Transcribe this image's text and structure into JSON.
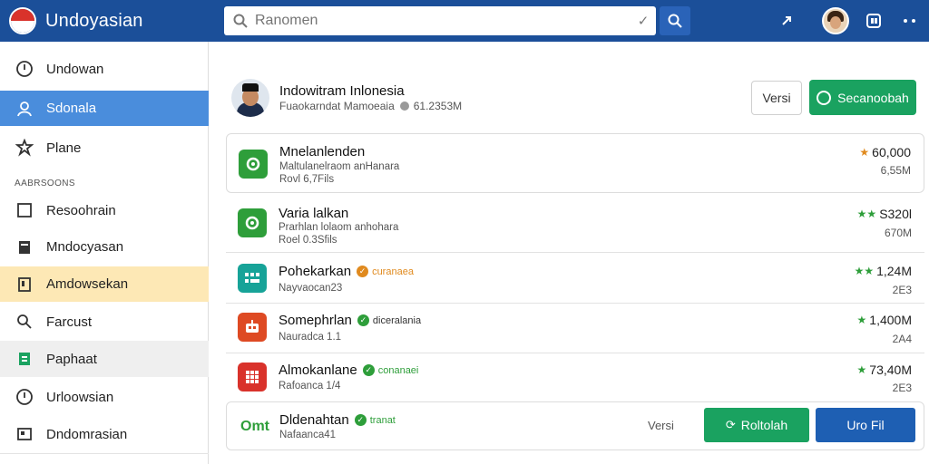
{
  "app": {
    "title": "Undoyasian"
  },
  "search": {
    "placeholder": "Ranomen"
  },
  "sidebar": {
    "items": [
      {
        "label": "Undowan",
        "icon": "compass-icon"
      },
      {
        "label": "Sdonala",
        "icon": "user-icon",
        "state": "active"
      },
      {
        "label": "Plane",
        "icon": "puzzle-icon"
      }
    ],
    "section_label": "AABRSOONS",
    "section_items": [
      {
        "label": "Resoohrain",
        "icon": "square-icon"
      },
      {
        "label": "Mndocyasan",
        "icon": "document-icon"
      },
      {
        "label": "Amdowsekan",
        "icon": "tablet-icon",
        "state": "highlighted"
      },
      {
        "label": "Farcust",
        "icon": "search-icon"
      },
      {
        "label": "Paphaat",
        "icon": "sheet-icon",
        "state": "hover"
      },
      {
        "label": "Urloowsian",
        "icon": "compass-icon"
      },
      {
        "label": "Dndomrasian",
        "icon": "image-icon"
      }
    ]
  },
  "profile": {
    "name": "Indowitram Inlonesia",
    "subtitle": "Fuaokarndat Mamoeaia",
    "size": "61.2353M"
  },
  "header_buttons": {
    "versi": "Versi",
    "primary": "Secanoobah"
  },
  "colors": {
    "topbar": "#1b4f99",
    "active": "#4a8ddc",
    "green": "#1aa260",
    "blue": "#1e5fb3",
    "highlight": "#fde8b5"
  },
  "apps": [
    {
      "title": "Mnelanlenden",
      "sub1": "Maltulanelraom anHanara",
      "sub2": "Rovl 6,7Fils",
      "stat": "60,000",
      "stat_sub": "6,55M",
      "star_color": "#e08a1e",
      "icon": "folder-icon"
    },
    {
      "title": "Varia lalkan",
      "sub1": "Prarhlan lolaom anhohara",
      "sub2": "Roel 0.3Sfils",
      "stat": "S320l",
      "stat_sub": "670M",
      "star_color": "#2e9e3a",
      "icon": "folder-icon"
    },
    {
      "title": "Pohekarkan",
      "badge": "curanaea",
      "badge_color": "#e08a1e",
      "sub1": "Nayvaocan23",
      "stat": "1,24M",
      "stat_sub": "2E3",
      "star_color": "#2e9e3a",
      "icon": "grid-icon"
    },
    {
      "title": "Somephrlan",
      "badge": "diceralania",
      "badge_color": "#2e9e3a",
      "sub1": "Nauradca 1.1",
      "stat": "1,400M",
      "stat_sub": "2A4",
      "star_color": "#2e9e3a",
      "icon": "robot-icon"
    },
    {
      "title": "Almokanlane",
      "badge": "conanaei",
      "badge_color": "#2e9e3a",
      "sub1": "Rafoanca 1/4",
      "stat": "73,40M",
      "stat_sub": "2E3",
      "star_color": "#2e9e3a",
      "icon": "apps-icon"
    },
    {
      "title": "Dldenahtan",
      "badge": "tranat",
      "badge_color": "#2e9e3a",
      "sub1": "Nafaanca41",
      "versi": "Versi",
      "btn_green": "Roltolah",
      "btn_blue": "Uro Fil",
      "icon": "omt-icon",
      "icon_text": "Omt"
    }
  ]
}
